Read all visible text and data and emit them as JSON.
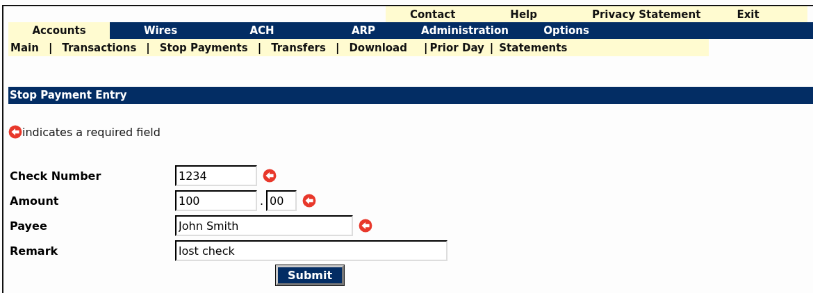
{
  "top_links": [
    {
      "label": "Contact"
    },
    {
      "label": "Help"
    },
    {
      "label": "Privacy Statement"
    },
    {
      "label": "Exit"
    }
  ],
  "tabs": [
    {
      "label": "Accounts",
      "selected": true
    },
    {
      "label": "Wires",
      "selected": false
    },
    {
      "label": "ACH",
      "selected": false
    },
    {
      "label": "ARP",
      "selected": false
    },
    {
      "label": "Administration",
      "selected": false
    },
    {
      "label": "Options",
      "selected": false
    }
  ],
  "subnav": [
    {
      "kind": "link",
      "label": "Main"
    },
    {
      "kind": "separator",
      "label": "|"
    },
    {
      "kind": "link",
      "label": "Transactions"
    },
    {
      "kind": "separator",
      "label": "|"
    },
    {
      "kind": "link",
      "label": "Stop Payments"
    },
    {
      "kind": "separator",
      "label": "|"
    },
    {
      "kind": "link",
      "label": "Transfers"
    },
    {
      "kind": "separator",
      "label": "|"
    },
    {
      "kind": "link",
      "label": "Download"
    },
    {
      "kind": "separator",
      "label": "|"
    },
    {
      "kind": "link",
      "label": "Prior Day"
    },
    {
      "kind": "separator",
      "label": "|"
    },
    {
      "kind": "link",
      "label": "Statements"
    }
  ],
  "section_title": "Stop Payment Entry",
  "required_note": "indicates a required field",
  "form": [
    {
      "label": "Check Number",
      "required": true,
      "fields": [
        {
          "value": "1234"
        }
      ]
    },
    {
      "label": "Amount",
      "required": true,
      "fields": [
        {
          "value": "100"
        },
        {
          "value": "00"
        }
      ],
      "joiner": "."
    },
    {
      "label": "Payee",
      "required": true,
      "fields": [
        {
          "value": "John Smith"
        }
      ]
    },
    {
      "label": "Remark",
      "required": false,
      "fields": [
        {
          "value": "lost check"
        }
      ]
    }
  ],
  "submit": "Submit"
}
